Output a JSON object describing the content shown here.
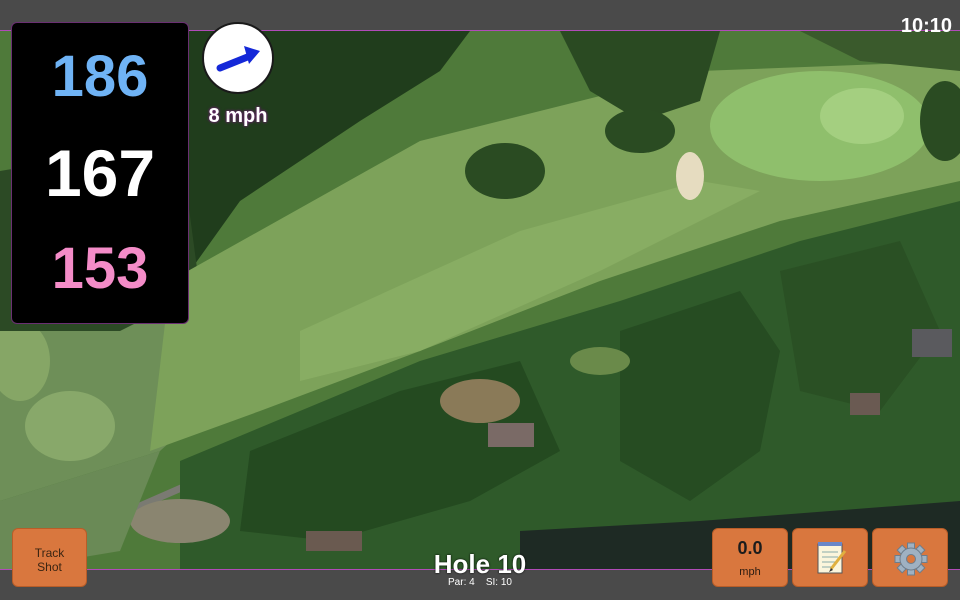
{
  "status": {
    "time": "10:10"
  },
  "yardages": {
    "back": "186",
    "center": "167",
    "front": "153"
  },
  "wind": {
    "speed_label": "8 mph",
    "icon": "wind-arrow-icon"
  },
  "hole": {
    "title": "Hole 10",
    "par_label": "Par: 4",
    "si_label": "SI: 10"
  },
  "buttons": {
    "track_shot_line1": "Track",
    "track_shot_line2": "Shot",
    "speed_value": "0.0",
    "speed_unit": "mph",
    "notes_icon": "notepad-icon",
    "settings_icon": "gear-icon"
  },
  "colors": {
    "back_yardage": "#6fb3f5",
    "center_yardage": "#ffffff",
    "front_yardage": "#f48cc8",
    "button": "#d9773e",
    "accent": "#b14bb8"
  }
}
